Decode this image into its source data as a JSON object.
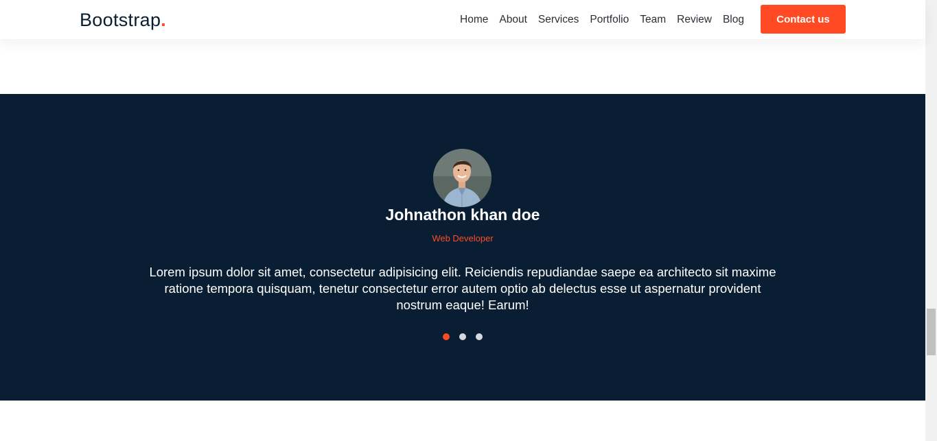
{
  "navbar": {
    "brand": "Bootstrap",
    "brand_dot": ".",
    "links": [
      "Home",
      "About",
      "Services",
      "Portfolio",
      "Team",
      "Review",
      "Blog"
    ],
    "contact_label": "Contact us"
  },
  "testimonial": {
    "name": "Johnathon khan doe",
    "role": "Web Developer",
    "quote": "Lorem ipsum dolor sit amet, consectetur adipisicing elit. Reiciendis repudiandae saepe ea architecto sit maxime ratione tempora quisquam, tenetur consectetur error autem optio ab delectus esse ut aspernatur provident nostrum eaque! Earum!",
    "slides": 3,
    "active_slide": 1
  },
  "colors": {
    "accent": "#ff4a24",
    "section_bg": "#0a1e33",
    "brand_text": "#0b1d31"
  }
}
